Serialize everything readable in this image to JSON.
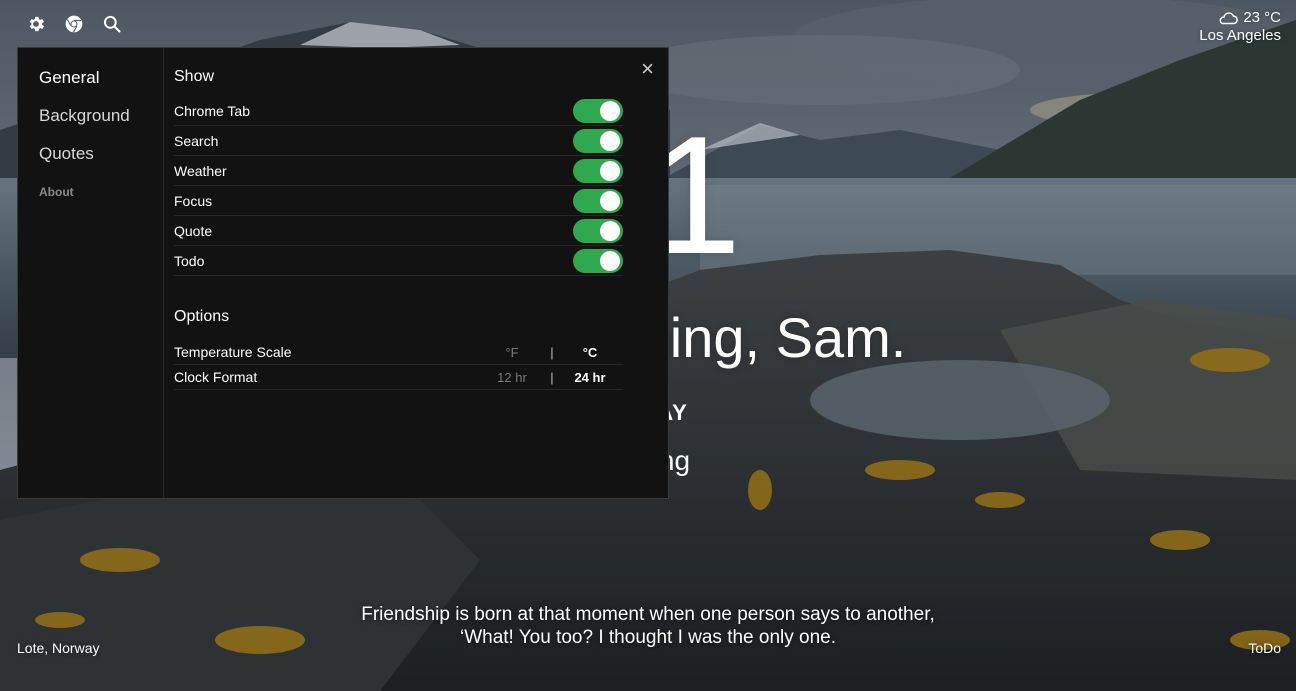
{
  "weather": {
    "icon": "cloud-icon",
    "temperature": "23 °C",
    "city": "Los Angeles"
  },
  "clock": {
    "time": "21"
  },
  "greeting": {
    "text": "Good morning, Sam."
  },
  "focus": {
    "question": "TODAY",
    "answer": "Sailing"
  },
  "quote": {
    "line1": "Friendship is born at that moment when one person says to another,",
    "line2": "‘What! You too? I thought I was the only one."
  },
  "footer": {
    "location": "Lote, Norway",
    "todo": "ToDo"
  },
  "topbar": {
    "icons": [
      "gear-icon",
      "chrome-icon",
      "search-icon"
    ]
  },
  "settings": {
    "close_label": "×",
    "nav": [
      "General",
      "Background",
      "Quotes",
      "About"
    ],
    "show_title": "Show",
    "show_items": [
      {
        "label": "Chrome Tab",
        "enabled": true
      },
      {
        "label": "Search",
        "enabled": true
      },
      {
        "label": "Weather",
        "enabled": true
      },
      {
        "label": "Focus",
        "enabled": true
      },
      {
        "label": "Quote",
        "enabled": true
      },
      {
        "label": "Todo",
        "enabled": true
      }
    ],
    "options_title": "Options",
    "options": [
      {
        "label": "Temperature Scale",
        "choice1": "°F",
        "separator": "|",
        "choice2": "°C",
        "selected": "°C"
      },
      {
        "label": "Clock Format",
        "choice1": "12 hr",
        "separator": "|",
        "choice2": "24 hr",
        "selected": "24 hr"
      }
    ]
  },
  "colors": {
    "toggle_on": "#2fa84f",
    "panel_bg": "#121212"
  }
}
